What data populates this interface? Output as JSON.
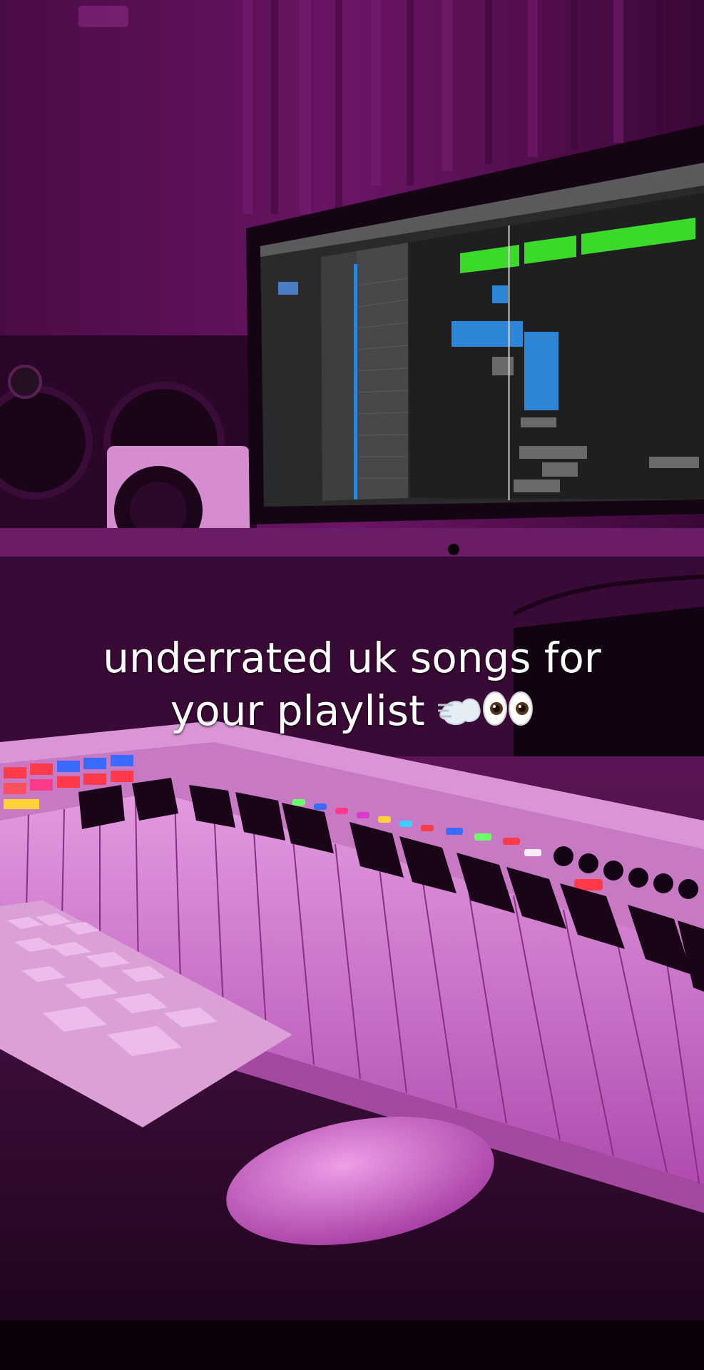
{
  "caption": {
    "line1": "underrated uk songs for",
    "line2": "your playlist"
  },
  "emoji_icons": [
    "dash-icon",
    "eyes-icon"
  ],
  "colors": {
    "tint": "#8a1d84",
    "wall": "#5a1156",
    "daw_clip_green": "#3bd92a",
    "daw_clip_blue": "#2e86d6",
    "caption_text": "#ffffff"
  }
}
